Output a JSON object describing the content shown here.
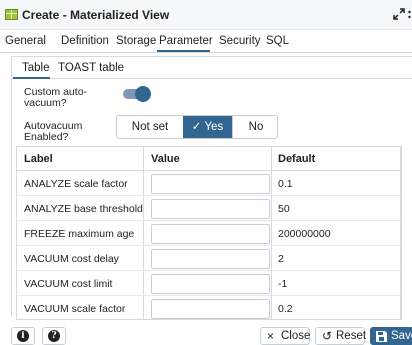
{
  "window": {
    "title": "Create - Materialized View"
  },
  "tabs": [
    "General",
    "Definition",
    "Storage",
    "Parameter",
    "Security",
    "SQL"
  ],
  "active_tab": "Parameter",
  "subtabs": [
    "Table",
    "TOAST table"
  ],
  "active_subtab": "Table",
  "form": {
    "custom_autovacuum_label": [
      "Custom auto-",
      "vacuum?"
    ],
    "custom_autovacuum_on": true,
    "autovacuum_enabled_label": [
      "Autovacuum",
      "Enabled?"
    ],
    "autovacuum_options": [
      "Not set",
      "Yes",
      "No"
    ],
    "autovacuum_selected": "Yes",
    "yes_check": "✓"
  },
  "table": {
    "headers": [
      "Label",
      "Value",
      "Default"
    ],
    "rows": [
      {
        "label": "ANALYZE scale factor",
        "value": "",
        "default": "0.1"
      },
      {
        "label": "ANALYZE base threshold",
        "value": "",
        "default": "50"
      },
      {
        "label": "FREEZE maximum age",
        "value": "",
        "default": "200000000"
      },
      {
        "label": "VACUUM cost delay",
        "value": "",
        "default": "2"
      },
      {
        "label": "VACUUM cost limit",
        "value": "",
        "default": "-1"
      },
      {
        "label": "VACUUM scale factor",
        "value": "",
        "default": "0.2"
      }
    ]
  },
  "footer": {
    "info_glyph": "i",
    "help_glyph": "?",
    "close_label": "Close",
    "close_icon": "×",
    "reset_label": "Reset",
    "reset_icon": "↺",
    "save_label": "Save",
    "save_icon": "floppy-disk-icon"
  },
  "colors": {
    "accent": "#326690",
    "title_icon": "#9ac43a"
  }
}
